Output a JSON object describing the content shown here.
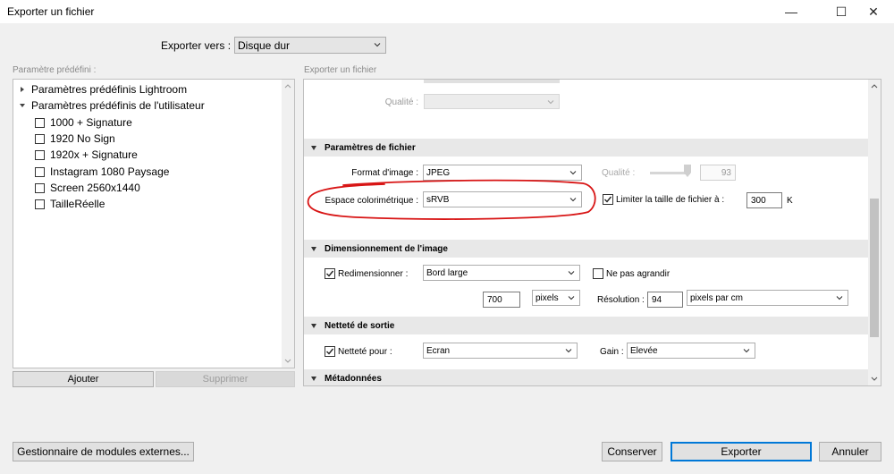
{
  "window": {
    "title": "Exporter un fichier",
    "minimize_glyph": "—",
    "maximize_glyph": "☐",
    "close_glyph": "✕"
  },
  "header": {
    "export_to_label": "Exporter vers :",
    "export_to_value": "Disque dur"
  },
  "presets": {
    "label": "Paramètre prédéfini :",
    "groups": [
      {
        "label": "Paramètres prédéfinis Lightroom",
        "expanded": false
      },
      {
        "label": "Paramètres prédéfinis de l'utilisateur",
        "expanded": true
      }
    ],
    "items": [
      "1000 + Signature",
      "1920 No Sign",
      "1920x + Signature",
      "Instagram 1080 Paysage",
      "Screen 2560x1440",
      "TailleRéelle"
    ],
    "add_button": "Ajouter",
    "remove_button": "Supprimer"
  },
  "export_panel": {
    "label": "Exporter un fichier",
    "top_quality_label": "Qualité :",
    "file_settings": {
      "title": "Paramètres de fichier",
      "format_label": "Format d'image :",
      "format_value": "JPEG",
      "quality_label": "Qualité :",
      "quality_value": "93",
      "quality_level": 0.93,
      "colorspace_label": "Espace colorimétrique :",
      "colorspace_value": "sRVB",
      "limit_label": "Limiter la taille de fichier à :",
      "limit_checked": true,
      "limit_value": "300",
      "limit_unit": "K"
    },
    "sizing": {
      "title": "Dimensionnement de l'image",
      "resize_label": "Redimensionner :",
      "resize_checked": true,
      "resize_value": "Bord large",
      "dont_enlarge_label": "Ne pas agrandir",
      "dont_enlarge_checked": false,
      "size_value": "700",
      "size_unit": "pixels",
      "resolution_label": "Résolution :",
      "resolution_value": "94",
      "resolution_unit": "pixels par cm"
    },
    "sharpening": {
      "title": "Netteté de sortie",
      "sharpen_label": "Netteté pour :",
      "sharpen_checked": true,
      "sharpen_value": "Ecran",
      "amount_label": "Gain :",
      "amount_value": "Elevée"
    },
    "metadata": {
      "title": "Métadonnées"
    }
  },
  "footer": {
    "plugin_manager_button": "Gestionnaire de modules externes...",
    "save_button": "Conserver",
    "export_button": "Exporter",
    "cancel_button": "Annuler"
  },
  "colors": {
    "annotation": "#d81515",
    "primary_border": "#0078d7"
  }
}
